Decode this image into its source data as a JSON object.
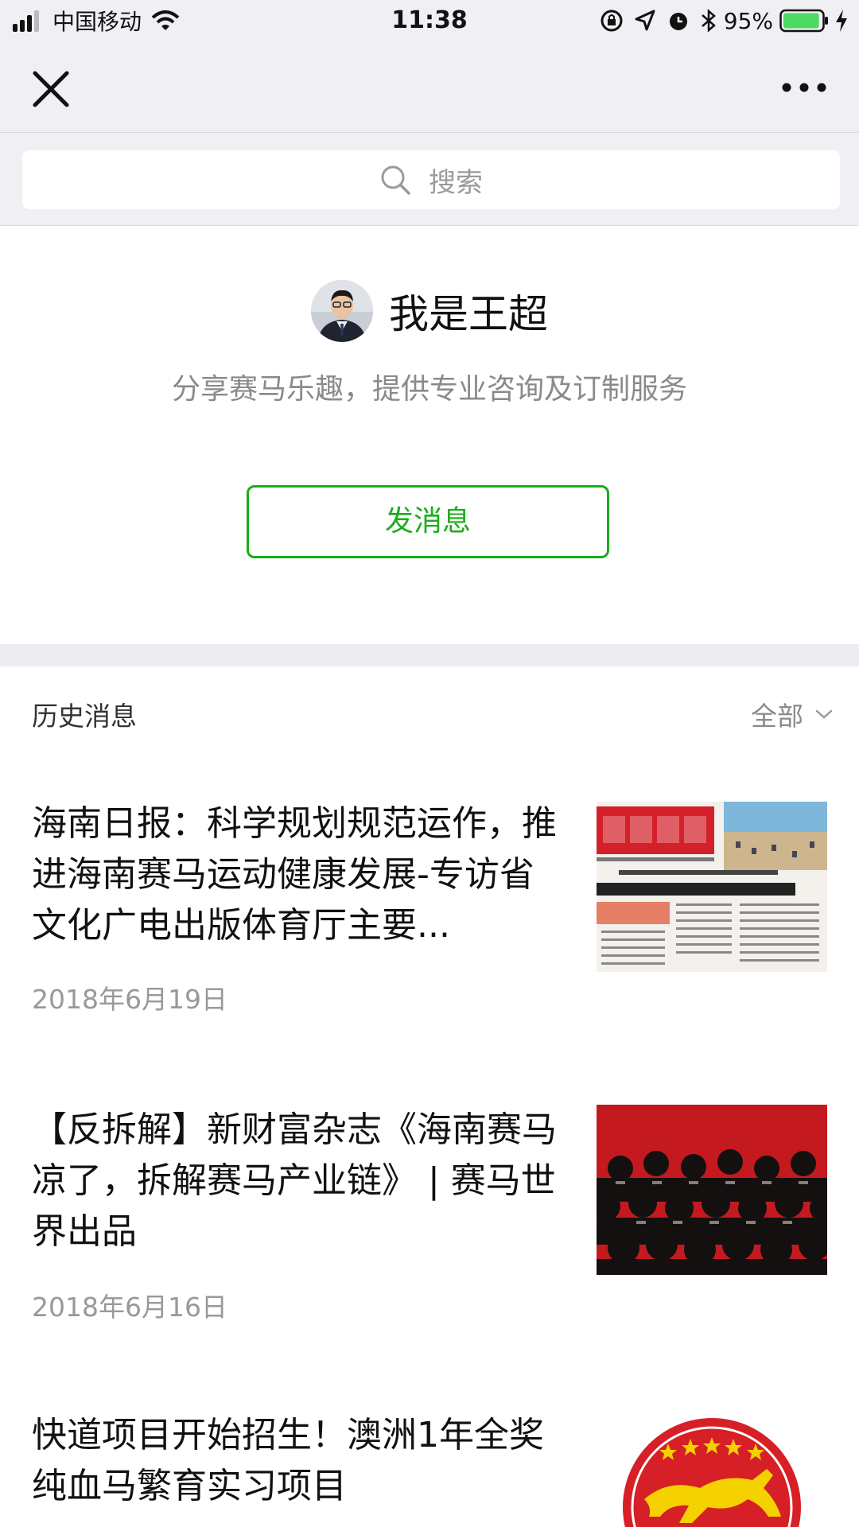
{
  "status_bar": {
    "carrier": "中国移动",
    "time": "11:38",
    "battery_percent": "95%",
    "battery_level": 0.95
  },
  "nav": {
    "close_icon": "close-icon",
    "more_icon": "more-icon"
  },
  "search": {
    "placeholder": "搜索",
    "icon": "search-icon"
  },
  "profile": {
    "name": "我是王超",
    "description": "分享赛马乐趣，提供专业咨询及订制服务",
    "message_button": "发消息"
  },
  "history": {
    "title": "历史消息",
    "filter_label": "全部",
    "articles": [
      {
        "title": "海南日报：科学规划规范运作，推进海南赛马运动健康发展-专访省文化广电出版体育厅主要...",
        "date": "2018年6月19日",
        "thumb": "newspaper-thumbnail"
      },
      {
        "title": "【反拆解】新财富杂志《海南赛马凉了，拆解赛马产业链》 | 赛马世界出品",
        "date": "2018年6月16日",
        "thumb": "crowd-poster-thumbnail"
      },
      {
        "title": "快道项目开始招生！澳洲1年全奖纯血马繁育实习项目",
        "date": "",
        "thumb": "horse-logo-thumbnail"
      }
    ]
  },
  "colors": {
    "accent_green": "#1aad19",
    "nav_background": "#efeff4"
  }
}
